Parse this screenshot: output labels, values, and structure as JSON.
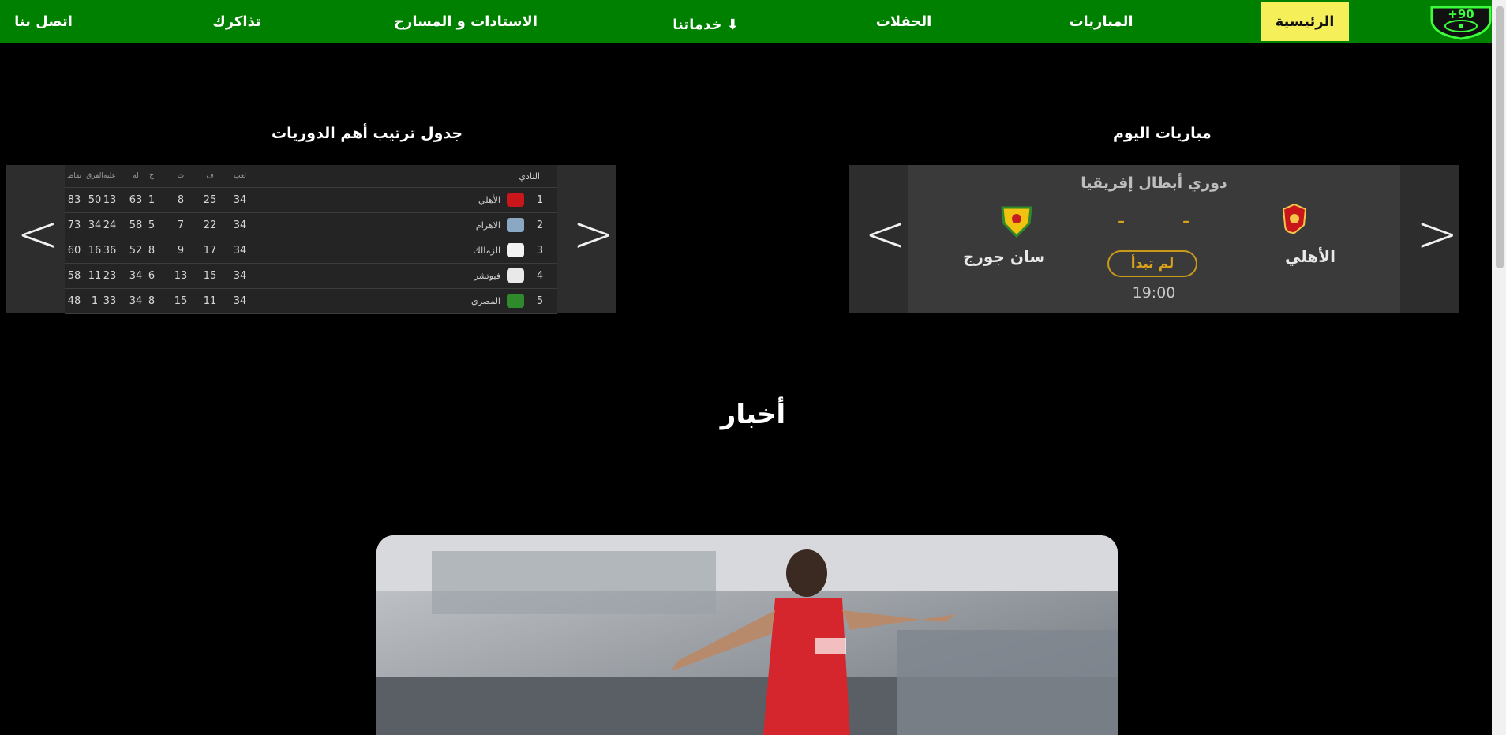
{
  "nav": {
    "logo_text": "+90",
    "items": [
      {
        "label": "الرئيسية",
        "active": true
      },
      {
        "label": "المباريات"
      },
      {
        "label": "الحفلات"
      },
      {
        "label": "خدماتنا ⬇"
      },
      {
        "label": "الاستادات و المسارح"
      },
      {
        "label": "تذاكرك"
      },
      {
        "label": "اتصل بنا"
      }
    ]
  },
  "matches": {
    "title": "مباريات اليوم",
    "league": "دوري أبطال إفريقيا",
    "home_team": "الأهلي",
    "away_team": "سان جورج",
    "home_score": "-",
    "away_score": "-",
    "status": "لم تبدأ",
    "time": "19:00",
    "prev": "<",
    "next": ">"
  },
  "standings": {
    "title": "جدول ترتيب أهم الدوريات",
    "prev": "<",
    "next": ">",
    "headers": {
      "team": "النادي",
      "played": "لعب",
      "won": "ف",
      "draw": "ت",
      "lost": "خ",
      "for": "له",
      "against": "عليه",
      "diff": "الفرق",
      "points": "نقاط"
    },
    "rows": [
      {
        "rank": "1",
        "team": "الأهلي",
        "played": "34",
        "won": "25",
        "draw": "8",
        "lost": "1",
        "for": "63",
        "against": "13",
        "diff": "50",
        "points": "83"
      },
      {
        "rank": "2",
        "team": "الاهرام",
        "played": "34",
        "won": "22",
        "draw": "7",
        "lost": "5",
        "for": "58",
        "against": "24",
        "diff": "34",
        "points": "73"
      },
      {
        "rank": "3",
        "team": "الزمالك",
        "played": "34",
        "won": "17",
        "draw": "9",
        "lost": "8",
        "for": "52",
        "against": "36",
        "diff": "16",
        "points": "60"
      },
      {
        "rank": "4",
        "team": "فيوتشر",
        "played": "34",
        "won": "15",
        "draw": "13",
        "lost": "6",
        "for": "34",
        "against": "23",
        "diff": "11",
        "points": "58"
      },
      {
        "rank": "5",
        "team": "المصري",
        "played": "34",
        "won": "11",
        "draw": "15",
        "lost": "8",
        "for": "34",
        "against": "33",
        "diff": "1",
        "points": "48"
      }
    ]
  },
  "news": {
    "title": "أخبار"
  },
  "colors": {
    "nav_bg": "#008000",
    "active_bg": "#f5ef5a",
    "accent_gold": "#d9a21b"
  }
}
